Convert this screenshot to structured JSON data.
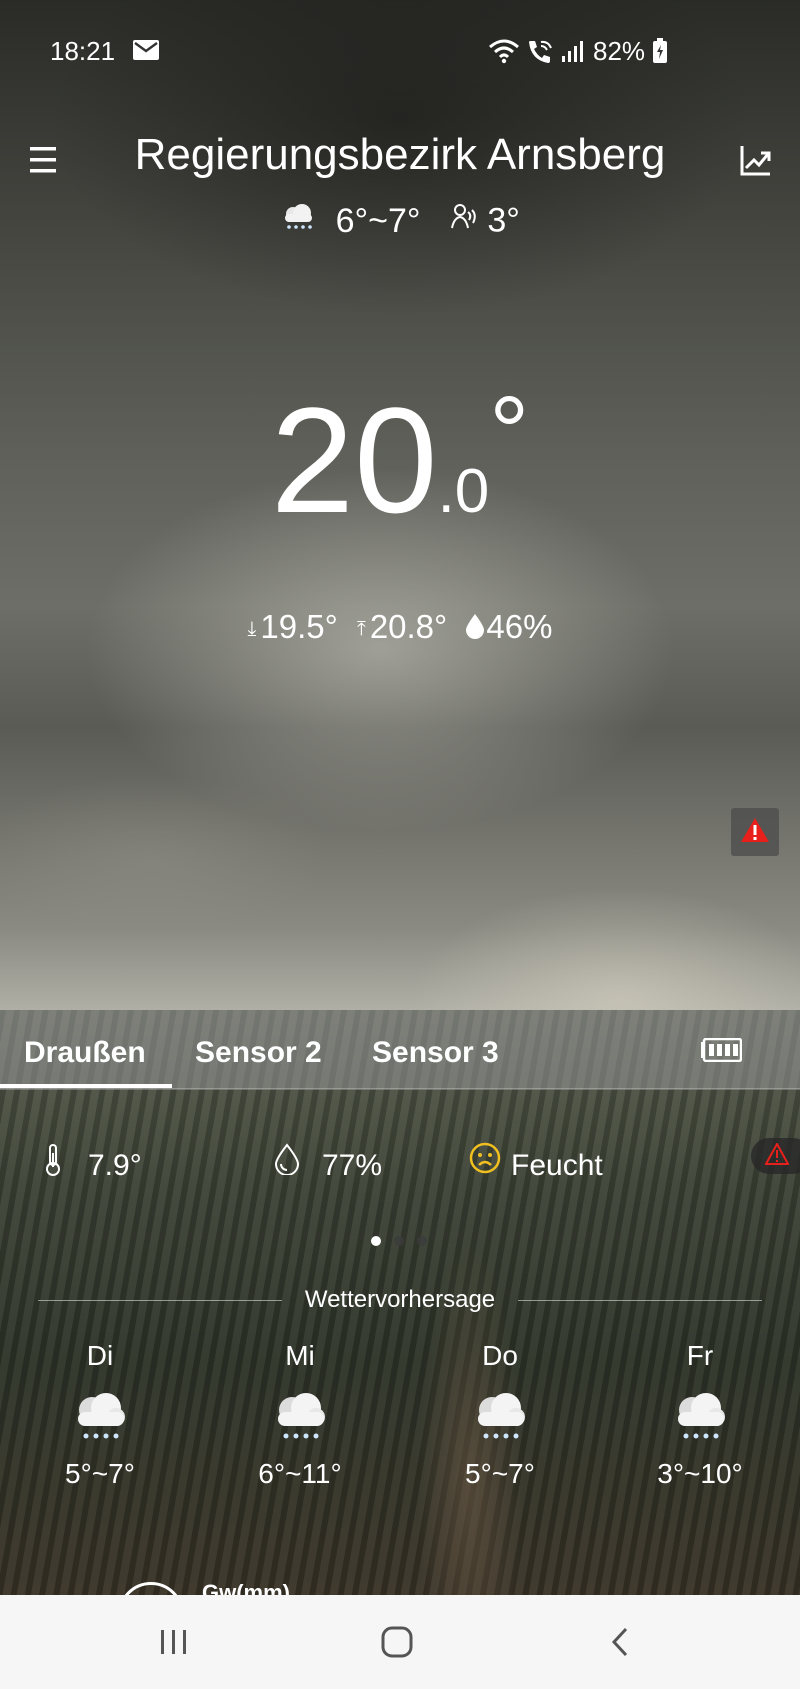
{
  "status_bar": {
    "time": "18:21",
    "battery": "82%",
    "icons": [
      "mail-icon",
      "wifi-icon",
      "wifi-calling-icon",
      "signal-icon",
      "battery-charging-icon"
    ]
  },
  "header": {
    "location": "Regierungsbezirk Arnsberg",
    "forecast_range": "6°~7°",
    "feels_like": "3°",
    "menu_icon": "menu-icon",
    "chart_icon": "trend-chart-icon"
  },
  "current": {
    "temp_int": "20",
    "temp_dec": ".0",
    "temp_unit": "°",
    "min": "19.5°",
    "max": "20.8°",
    "humidity": "46%"
  },
  "tabs": [
    {
      "label": "Draußen",
      "active": true
    },
    {
      "label": "Sensor 2",
      "active": false
    },
    {
      "label": "Sensor 3",
      "active": false
    }
  ],
  "sensor": {
    "temperature": "7.9°",
    "humidity": "77%",
    "comfort": "Feucht",
    "page_index": 0,
    "page_count": 3
  },
  "forecast": {
    "title": "Wettervorhersage",
    "days": [
      {
        "day": "Di",
        "range": "5°~7°",
        "icon": "snow-cloud-icon"
      },
      {
        "day": "Mi",
        "range": "6°~11°",
        "icon": "snow-cloud-icon"
      },
      {
        "day": "Do",
        "range": "5°~7°",
        "icon": "snow-cloud-icon"
      },
      {
        "day": "Fr",
        "range": "3°~10°",
        "icon": "snow-cloud-icon"
      }
    ]
  },
  "peek_text": "Gw(mm)",
  "colors": {
    "warning": "#e8201b",
    "comfort_face": "#f0c020",
    "nav_bg": "#f6f6f6"
  }
}
